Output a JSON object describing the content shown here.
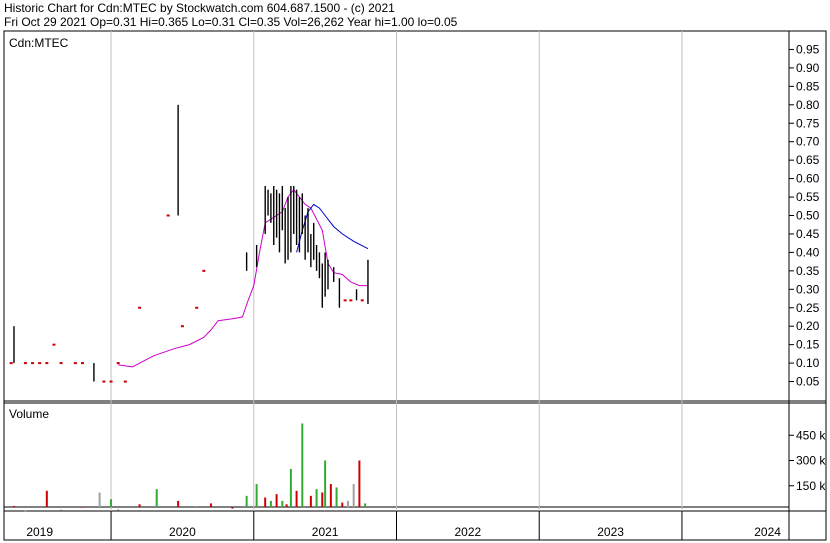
{
  "header": {
    "line1": "Historic Chart for Cdn:MTEC by Stockwatch.com 604.687.1500 - (c) 2021",
    "line2": "Fri Oct 29 2021  Op=0.31  Hi=0.365  Lo=0.31  Cl=0.35  Vol=26,262  Year hi=1.00  lo=0.05"
  },
  "colors": {
    "price_bar": "#000000",
    "flat_bar": "#cc0000",
    "ma_short": "#cc00cc",
    "ma_long": "#0000cc",
    "vol_up": "#33aa33",
    "vol_down": "#cc0000",
    "vol_flat": "#a0a0a0",
    "grid": "#c0c0c0"
  },
  "chart_data": [
    {
      "type": "line",
      "title": "Cdn:MTEC",
      "xlabel": "",
      "ylabel": "",
      "ylim": [
        0.0,
        1.0
      ],
      "yticks": [
        0.05,
        0.1,
        0.15,
        0.2,
        0.25,
        0.3,
        0.35,
        0.4,
        0.45,
        0.5,
        0.55,
        0.6,
        0.65,
        0.7,
        0.75,
        0.8,
        0.85,
        0.9,
        0.95
      ],
      "ytick_labels": [
        "0.05",
        "0.10",
        "0.15",
        "0.20",
        "0.25",
        "0.30",
        "0.35",
        "0.40",
        "0.45",
        "0.50",
        "0.55",
        "0.60",
        "0.65",
        "0.70",
        "0.75",
        "0.80",
        "0.85",
        "0.90",
        "0.95"
      ],
      "xlim": [
        2018.75,
        2024.25
      ],
      "x_labels": [
        {
          "label": "2019",
          "center": 2019.0
        },
        {
          "label": "2020",
          "center": 2020.0
        },
        {
          "label": "2021",
          "center": 2021.0
        },
        {
          "label": "2022",
          "center": 2022.0
        },
        {
          "label": "2023",
          "center": 2023.0
        },
        {
          "label": "2024",
          "center": 2024.1
        }
      ],
      "year_boundaries": [
        2019.5,
        2020.5,
        2021.5,
        2022.5,
        2023.5
      ],
      "grid": true,
      "bars": [
        {
          "t": 2018.8,
          "lo": 0.1,
          "hi": 0.1
        },
        {
          "t": 2018.82,
          "lo": 0.1,
          "hi": 0.2
        },
        {
          "t": 2018.9,
          "lo": 0.1,
          "hi": 0.1
        },
        {
          "t": 2018.95,
          "lo": 0.1,
          "hi": 0.1
        },
        {
          "t": 2019.0,
          "lo": 0.1,
          "hi": 0.1
        },
        {
          "t": 2019.05,
          "lo": 0.1,
          "hi": 0.1
        },
        {
          "t": 2019.1,
          "lo": 0.15,
          "hi": 0.15
        },
        {
          "t": 2019.15,
          "lo": 0.1,
          "hi": 0.1
        },
        {
          "t": 2019.25,
          "lo": 0.1,
          "hi": 0.1
        },
        {
          "t": 2019.3,
          "lo": 0.1,
          "hi": 0.1
        },
        {
          "t": 2019.38,
          "lo": 0.05,
          "hi": 0.1
        },
        {
          "t": 2019.45,
          "lo": 0.05,
          "hi": 0.05
        },
        {
          "t": 2019.5,
          "lo": 0.05,
          "hi": 0.05
        },
        {
          "t": 2019.55,
          "lo": 0.1,
          "hi": 0.1
        },
        {
          "t": 2019.6,
          "lo": 0.05,
          "hi": 0.05
        },
        {
          "t": 2019.7,
          "lo": 0.25,
          "hi": 0.25
        },
        {
          "t": 2019.9,
          "lo": 0.5,
          "hi": 0.5
        },
        {
          "t": 2019.97,
          "lo": 0.5,
          "hi": 0.8
        },
        {
          "t": 2020.0,
          "lo": 0.2,
          "hi": 0.2
        },
        {
          "t": 2020.1,
          "lo": 0.25,
          "hi": 0.25
        },
        {
          "t": 2020.15,
          "lo": 0.35,
          "hi": 0.35
        },
        {
          "t": 2020.45,
          "lo": 0.35,
          "hi": 0.4
        },
        {
          "t": 2020.52,
          "lo": 0.36,
          "hi": 0.42
        },
        {
          "t": 2020.58,
          "lo": 0.45,
          "hi": 0.58
        },
        {
          "t": 2020.6,
          "lo": 0.5,
          "hi": 0.57
        },
        {
          "t": 2020.62,
          "lo": 0.48,
          "hi": 0.56
        },
        {
          "t": 2020.64,
          "lo": 0.42,
          "hi": 0.58
        },
        {
          "t": 2020.66,
          "lo": 0.44,
          "hi": 0.57
        },
        {
          "t": 2020.68,
          "lo": 0.4,
          "hi": 0.56
        },
        {
          "t": 2020.7,
          "lo": 0.46,
          "hi": 0.58
        },
        {
          "t": 2020.72,
          "lo": 0.37,
          "hi": 0.52
        },
        {
          "t": 2020.74,
          "lo": 0.38,
          "hi": 0.55
        },
        {
          "t": 2020.76,
          "lo": 0.4,
          "hi": 0.58
        },
        {
          "t": 2020.78,
          "lo": 0.45,
          "hi": 0.58
        },
        {
          "t": 2020.8,
          "lo": 0.42,
          "hi": 0.57
        },
        {
          "t": 2020.82,
          "lo": 0.4,
          "hi": 0.55
        },
        {
          "t": 2020.84,
          "lo": 0.45,
          "hi": 0.56
        },
        {
          "t": 2020.86,
          "lo": 0.38,
          "hi": 0.5
        },
        {
          "t": 2020.88,
          "lo": 0.4,
          "hi": 0.52
        },
        {
          "t": 2020.9,
          "lo": 0.36,
          "hi": 0.45
        },
        {
          "t": 2020.92,
          "lo": 0.38,
          "hi": 0.48
        },
        {
          "t": 2020.94,
          "lo": 0.35,
          "hi": 0.42
        },
        {
          "t": 2020.96,
          "lo": 0.33,
          "hi": 0.4
        },
        {
          "t": 2020.98,
          "lo": 0.25,
          "hi": 0.37
        },
        {
          "t": 2021.0,
          "lo": 0.28,
          "hi": 0.4
        },
        {
          "t": 2021.02,
          "lo": 0.3,
          "hi": 0.38
        },
        {
          "t": 2021.06,
          "lo": 0.32,
          "hi": 0.36
        },
        {
          "t": 2021.1,
          "lo": 0.25,
          "hi": 0.33
        },
        {
          "t": 2021.14,
          "lo": 0.27,
          "hi": 0.27
        },
        {
          "t": 2021.18,
          "lo": 0.27,
          "hi": 0.27
        },
        {
          "t": 2021.22,
          "lo": 0.27,
          "hi": 0.3
        },
        {
          "t": 2021.26,
          "lo": 0.27,
          "hi": 0.27
        },
        {
          "t": 2021.3,
          "lo": 0.26,
          "hi": 0.38
        }
      ],
      "ma_short": [
        {
          "t": 2019.55,
          "v": 0.095
        },
        {
          "t": 2019.65,
          "v": 0.09
        },
        {
          "t": 2019.8,
          "v": 0.12
        },
        {
          "t": 2019.95,
          "v": 0.14
        },
        {
          "t": 2020.05,
          "v": 0.15
        },
        {
          "t": 2020.15,
          "v": 0.17
        },
        {
          "t": 2020.2,
          "v": 0.19
        },
        {
          "t": 2020.25,
          "v": 0.215
        },
        {
          "t": 2020.35,
          "v": 0.22
        },
        {
          "t": 2020.42,
          "v": 0.225
        },
        {
          "t": 2020.46,
          "v": 0.27
        },
        {
          "t": 2020.5,
          "v": 0.31
        },
        {
          "t": 2020.54,
          "v": 0.4
        },
        {
          "t": 2020.58,
          "v": 0.48
        },
        {
          "t": 2020.62,
          "v": 0.49
        },
        {
          "t": 2020.66,
          "v": 0.5
        },
        {
          "t": 2020.7,
          "v": 0.51
        },
        {
          "t": 2020.74,
          "v": 0.55
        },
        {
          "t": 2020.78,
          "v": 0.57
        },
        {
          "t": 2020.82,
          "v": 0.55
        },
        {
          "t": 2020.86,
          "v": 0.53
        },
        {
          "t": 2020.9,
          "v": 0.52
        },
        {
          "t": 2020.94,
          "v": 0.49
        },
        {
          "t": 2020.98,
          "v": 0.46
        },
        {
          "t": 2021.02,
          "v": 0.37
        },
        {
          "t": 2021.06,
          "v": 0.345
        },
        {
          "t": 2021.12,
          "v": 0.34
        },
        {
          "t": 2021.18,
          "v": 0.32
        },
        {
          "t": 2021.24,
          "v": 0.31
        },
        {
          "t": 2021.3,
          "v": 0.31
        }
      ],
      "ma_long": [
        {
          "t": 2020.8,
          "v": 0.4
        },
        {
          "t": 2020.84,
          "v": 0.46
        },
        {
          "t": 2020.88,
          "v": 0.51
        },
        {
          "t": 2020.92,
          "v": 0.53
        },
        {
          "t": 2020.96,
          "v": 0.52
        },
        {
          "t": 2021.0,
          "v": 0.5
        },
        {
          "t": 2021.06,
          "v": 0.47
        },
        {
          "t": 2021.12,
          "v": 0.45
        },
        {
          "t": 2021.2,
          "v": 0.43
        },
        {
          "t": 2021.3,
          "v": 0.41
        }
      ]
    },
    {
      "type": "bar",
      "title": "Volume",
      "xlabel": "",
      "ylabel": "",
      "ylim": [
        0,
        600000
      ],
      "yticks": [
        150000,
        300000,
        450000
      ],
      "ytick_labels": [
        "150 k",
        "300 k",
        "450 k"
      ],
      "bars": [
        {
          "t": 2018.82,
          "v": 30000,
          "d": "down"
        },
        {
          "t": 2018.9,
          "v": 5000,
          "d": "flat"
        },
        {
          "t": 2019.05,
          "v": 120000,
          "d": "down"
        },
        {
          "t": 2019.15,
          "v": 8000,
          "d": "flat"
        },
        {
          "t": 2019.3,
          "v": 25000,
          "d": "down"
        },
        {
          "t": 2019.42,
          "v": 110000,
          "d": "flat"
        },
        {
          "t": 2019.5,
          "v": 70000,
          "d": "up"
        },
        {
          "t": 2019.55,
          "v": 10000,
          "d": "flat"
        },
        {
          "t": 2019.7,
          "v": 40000,
          "d": "down"
        },
        {
          "t": 2019.82,
          "v": 130000,
          "d": "up"
        },
        {
          "t": 2019.97,
          "v": 60000,
          "d": "down"
        },
        {
          "t": 2020.1,
          "v": 30000,
          "d": "flat"
        },
        {
          "t": 2020.2,
          "v": 45000,
          "d": "down"
        },
        {
          "t": 2020.35,
          "v": 20000,
          "d": "down"
        },
        {
          "t": 2020.45,
          "v": 90000,
          "d": "up"
        },
        {
          "t": 2020.52,
          "v": 160000,
          "d": "up"
        },
        {
          "t": 2020.58,
          "v": 80000,
          "d": "down"
        },
        {
          "t": 2020.62,
          "v": 60000,
          "d": "up"
        },
        {
          "t": 2020.66,
          "v": 100000,
          "d": "down"
        },
        {
          "t": 2020.7,
          "v": 60000,
          "d": "up"
        },
        {
          "t": 2020.73,
          "v": 40000,
          "d": "down"
        },
        {
          "t": 2020.76,
          "v": 250000,
          "d": "up"
        },
        {
          "t": 2020.8,
          "v": 120000,
          "d": "down"
        },
        {
          "t": 2020.84,
          "v": 520000,
          "d": "up"
        },
        {
          "t": 2020.9,
          "v": 90000,
          "d": "down"
        },
        {
          "t": 2020.94,
          "v": 130000,
          "d": "up"
        },
        {
          "t": 2020.98,
          "v": 110000,
          "d": "down"
        },
        {
          "t": 2021.0,
          "v": 300000,
          "d": "up"
        },
        {
          "t": 2021.04,
          "v": 160000,
          "d": "down"
        },
        {
          "t": 2021.08,
          "v": 140000,
          "d": "up"
        },
        {
          "t": 2021.12,
          "v": 50000,
          "d": "down"
        },
        {
          "t": 2021.16,
          "v": 60000,
          "d": "flat"
        },
        {
          "t": 2021.2,
          "v": 160000,
          "d": "flat"
        },
        {
          "t": 2021.24,
          "v": 300000,
          "d": "down"
        },
        {
          "t": 2021.28,
          "v": 45000,
          "d": "up"
        }
      ]
    }
  ]
}
